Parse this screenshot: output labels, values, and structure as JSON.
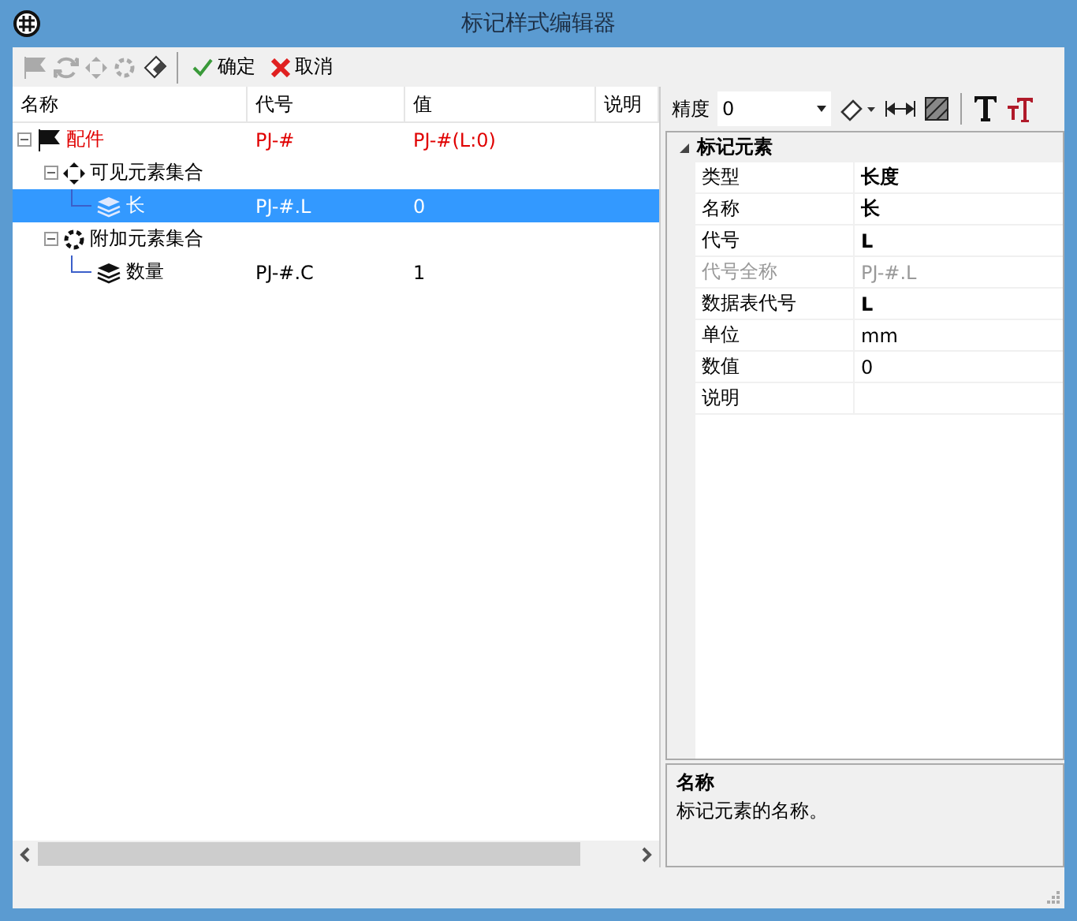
{
  "window": {
    "title": "标记样式编辑器"
  },
  "toolbar": {
    "icons": [
      {
        "kind": "flag",
        "disabled": true
      },
      {
        "kind": "refresh",
        "disabled": true
      },
      {
        "kind": "group",
        "disabled": true
      },
      {
        "kind": "group-extra",
        "disabled": true
      },
      {
        "kind": "eraser",
        "disabled": false
      }
    ],
    "buttons": [
      {
        "kind": "ok",
        "label": "确定"
      },
      {
        "kind": "cancel",
        "label": "取消"
      }
    ]
  },
  "tree": {
    "columns": [
      "名称",
      "代号",
      "值",
      "说明"
    ],
    "items": [
      {
        "kind": "flag",
        "name": "配件",
        "code": "PJ-#",
        "value": "PJ-#(L:0)",
        "highlighted": true,
        "selected": false,
        "expanded": true,
        "children": [
          {
            "kind": "group",
            "name": "可见元素集合",
            "highlighted": false,
            "selected": false,
            "expanded": true,
            "children": [
              {
                "kind": "layer",
                "name": "长",
                "code": "PJ-#.L",
                "value": "0",
                "highlighted": false,
                "selected": true
              }
            ]
          },
          {
            "kind": "group-extra",
            "name": "附加元素集合",
            "highlighted": false,
            "selected": false,
            "expanded": true,
            "children": [
              {
                "kind": "layer",
                "name": "数量",
                "code": "PJ-#.C",
                "value": "1",
                "highlighted": false,
                "selected": false
              }
            ]
          }
        ]
      }
    ]
  },
  "properties_toolbar": {
    "precision_label": "精度",
    "precision_value": "0"
  },
  "properties": {
    "category": "标记元素",
    "expanded": true,
    "rows": [
      {
        "name": "类型",
        "value": "长度",
        "bold": true,
        "disabled": false
      },
      {
        "name": "名称",
        "value": "长",
        "bold": true,
        "disabled": false
      },
      {
        "name": "代号",
        "value": "L",
        "bold": true,
        "disabled": false
      },
      {
        "name": "代号全称",
        "value": "PJ-#.L",
        "bold": false,
        "disabled": true
      },
      {
        "name": "数据表代号",
        "value": "L",
        "bold": true,
        "disabled": false
      },
      {
        "name": "单位",
        "value": "mm",
        "bold": false,
        "disabled": false
      },
      {
        "name": "数值",
        "value": "0",
        "bold": false,
        "disabled": false
      },
      {
        "name": "说明",
        "bold": false,
        "disabled": false
      }
    ]
  },
  "description": {
    "title": "名称",
    "text": "标记元素的名称。"
  }
}
